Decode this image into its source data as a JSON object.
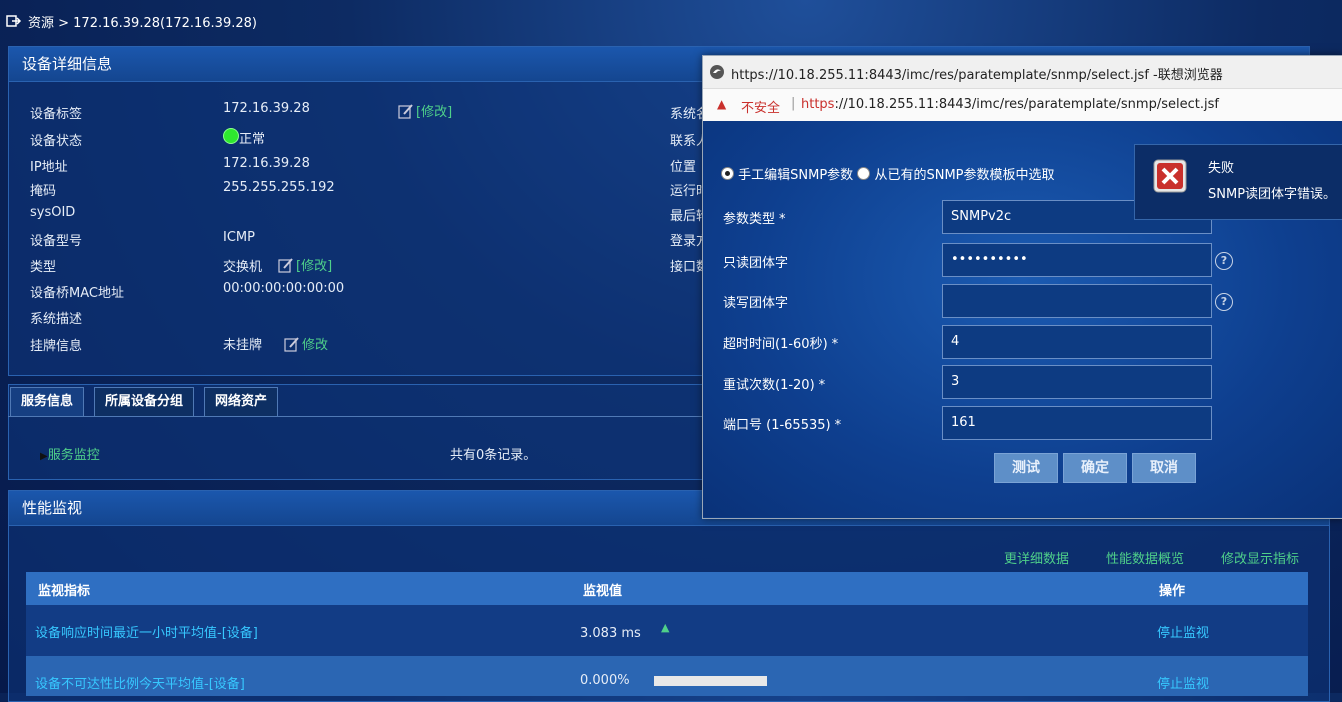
{
  "breadcrumb": {
    "text": "资源 > 172.16.39.28(172.16.39.28)"
  },
  "device_panel": {
    "title": "设备详细信息",
    "rows": [
      {
        "label": "设备标签",
        "value": "172.16.39.28"
      },
      {
        "label": "设备状态",
        "value": "正常"
      },
      {
        "label": "IP地址",
        "value": "172.16.39.28"
      },
      {
        "label": "掩码",
        "value": "255.255.255.192"
      },
      {
        "label": "sysOID",
        "value": ""
      },
      {
        "label": "设备型号",
        "value": "ICMP"
      },
      {
        "label": "类型",
        "value": "交换机"
      },
      {
        "label": "设备桥MAC地址",
        "value": "00:00:00:00:00:00"
      },
      {
        "label": "系统描述",
        "value": ""
      },
      {
        "label": "挂牌信息",
        "value": "未挂牌"
      }
    ],
    "edit_label_bracketed": "[修改]",
    "edit_label_plain": "修改",
    "right_partial_labels": [
      "系统名",
      "联系人",
      "位置",
      "运行时",
      "最后轮",
      "登录方",
      "接口数"
    ]
  },
  "tabs": {
    "items": [
      "服务信息",
      "所属设备分组",
      "网络资产"
    ],
    "service_monitor": "服务监控",
    "record_count": "共有0条记录。"
  },
  "performance": {
    "title": "性能监视",
    "links": [
      "更详细数据",
      "性能数据概览",
      "修改显示指标"
    ],
    "headers": [
      "监视指标",
      "监视值",
      "操作"
    ],
    "rows": [
      {
        "metric": "设备响应时间最近一小时平均值-[设备]",
        "value": "3.083 ms",
        "action": "停止监视"
      },
      {
        "metric": "设备不可达性比例今天平均值-[设备]",
        "value": "0.000%",
        "action": "停止监视"
      }
    ]
  },
  "popup": {
    "window_title": "https://10.18.255.11:8443/imc/res/paratemplate/snmp/select.jsf -联想浏览器",
    "insecure_label": "不安全",
    "url_scheme": "https",
    "url_rest": "://10.18.255.11:8443/imc/res/paratemplate/snmp/select.jsf",
    "radio_manual": "手工编辑SNMP参数",
    "radio_template": "从已有的SNMP参数模板中选取",
    "fields": {
      "param_type": {
        "label": "参数类型",
        "value": "SNMPv2c"
      },
      "read_community": {
        "label": "只读团体字",
        "value": "••••••••••"
      },
      "write_community": {
        "label": "读写团体字",
        "value": ""
      },
      "timeout": {
        "label": "超时时间(1-60秒)",
        "value": "4"
      },
      "retries": {
        "label": "重试次数(1-20)",
        "value": "3"
      },
      "port": {
        "label": "端口号 (1-65535)",
        "value": "161"
      }
    },
    "required_mark": "*",
    "buttons": {
      "test": "测试",
      "ok": "确定",
      "cancel": "取消"
    }
  },
  "toast": {
    "title": "失败",
    "message": "SNMP读团体字错误。"
  },
  "colors": {
    "link_green": "#4fd08a",
    "link_blue": "#37c8ff",
    "status_ok": "#2ee82e",
    "error_red": "#c9302c"
  }
}
